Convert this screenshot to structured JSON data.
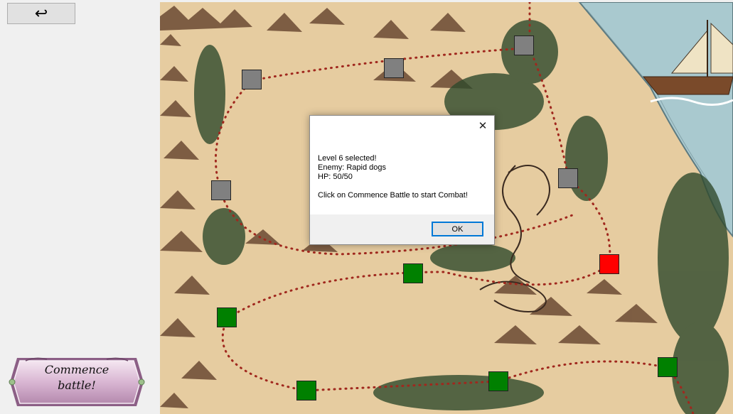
{
  "toolbar": {
    "back_glyph": "↩",
    "back_icon": "return-arrow-icon"
  },
  "commence_button": {
    "label": "Commence\nbattle!"
  },
  "map": {
    "nodes": [
      {
        "name": "level-node-1",
        "state": "done"
      },
      {
        "name": "level-node-2",
        "state": "done"
      },
      {
        "name": "level-node-3",
        "state": "done"
      },
      {
        "name": "level-node-4",
        "state": "done"
      },
      {
        "name": "level-node-5",
        "state": "done"
      },
      {
        "name": "level-node-6",
        "state": "selected"
      },
      {
        "name": "level-node-7",
        "state": "locked"
      },
      {
        "name": "level-node-8",
        "state": "locked"
      },
      {
        "name": "level-node-9",
        "state": "locked"
      },
      {
        "name": "level-node-10",
        "state": "locked"
      },
      {
        "name": "level-node-11",
        "state": "locked"
      },
      {
        "name": "level-node-12",
        "state": "done"
      }
    ],
    "colors": {
      "locked": "#808080",
      "done": "#008000",
      "selected": "#ff0000",
      "path": "#a0281e",
      "sea": "#a9c9cf",
      "parchment": "#e8cfa4"
    }
  },
  "dialog": {
    "lines": [
      "Level 6 selected!",
      "Enemy: Rapid dogs",
      "HP: 50/50",
      "",
      "Click on Commence Battle to start Combat!"
    ],
    "ok_label": "OK",
    "close_glyph": "✕"
  }
}
